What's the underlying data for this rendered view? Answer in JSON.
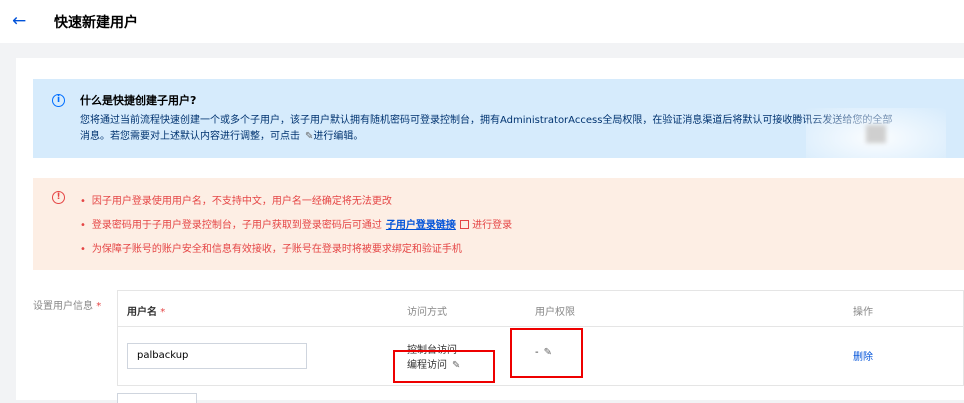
{
  "header": {
    "title": "快速新建用户"
  },
  "info": {
    "heading": "什么是快捷创建子用户?",
    "line1": "您将通过当前流程快速创建一个或多个子用户，该子用户默认拥有随机密码可登录控制台，拥有AdministratorAccess全局权限，在验证消息渠道后将默认可接收腾讯云发送给您的全部",
    "line2": "消息。若您需要对上述默认内容进行调整，可点击",
    "line2_suffix": "进行编辑。"
  },
  "warnings": [
    "因子用户登录使用用户名，不支持中文，用户名一经确定将无法更改",
    "登录密码用于子用户登录控制台，子用户获取到登录密码后可通过",
    "为保障子账号的账户安全和信息有效接收，子账号在登录时将被要求绑定和验证手机"
  ],
  "warning_link": "子用户登录链接",
  "warning_link_suffix": "进行登录",
  "form_label": "设置用户信息",
  "table": {
    "headers": [
      "用户名",
      "访问方式",
      "用户权限",
      "操作"
    ],
    "row": {
      "username": "palbackup",
      "access_console": "控制台访问",
      "access_program": "编程访问",
      "permission": "-",
      "action": "删除"
    }
  },
  "colors": {
    "accent": "#0052d9",
    "danger": "#e54545",
    "info_bg": "#d6ebfc",
    "warn_bg": "#fdeee4"
  }
}
